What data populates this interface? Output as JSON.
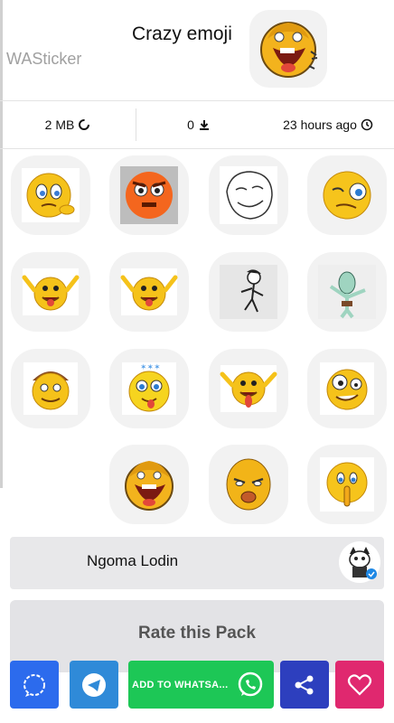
{
  "header": {
    "title": "Crazy emoji",
    "brand": "WASticker"
  },
  "stats": {
    "size": "2 MB",
    "downloads": "0",
    "updated": "23 hours ago"
  },
  "stickers": [
    {
      "id": "s1",
      "icon": "confused-emoji"
    },
    {
      "id": "s2",
      "icon": "angry-emoji"
    },
    {
      "id": "s3",
      "icon": "meme-face"
    },
    {
      "id": "s4",
      "icon": "skeptical-emoji"
    },
    {
      "id": "s5",
      "icon": "tongue-emoji"
    },
    {
      "id": "s6",
      "icon": "tongue-emoji"
    },
    {
      "id": "s7",
      "icon": "dancing-man"
    },
    {
      "id": "s8",
      "icon": "dabbing-squid"
    },
    {
      "id": "s9",
      "icon": "hat-emoji"
    },
    {
      "id": "s10",
      "icon": "dizzy-emoji"
    },
    {
      "id": "s11",
      "icon": "tongue-emoji"
    },
    {
      "id": "s12",
      "icon": "crazy-eyes-emoji"
    },
    {
      "id": "s13",
      "icon": "screaming-emoji"
    },
    {
      "id": "s14",
      "icon": "smug-face"
    },
    {
      "id": "s15",
      "icon": "shush-emoji"
    }
  ],
  "author": {
    "name": "Ngoma Lodin",
    "verified": true
  },
  "rate": {
    "label": "Rate this Pack"
  },
  "actions": {
    "signal_color": "#2c6bed",
    "telegram_color": "#2f8ad8",
    "whatsapp_label": "ADD TO WHATSA...",
    "whatsapp_color": "#1dc756",
    "share_color": "#2d3fbe",
    "favorite_color": "#e0286f"
  }
}
